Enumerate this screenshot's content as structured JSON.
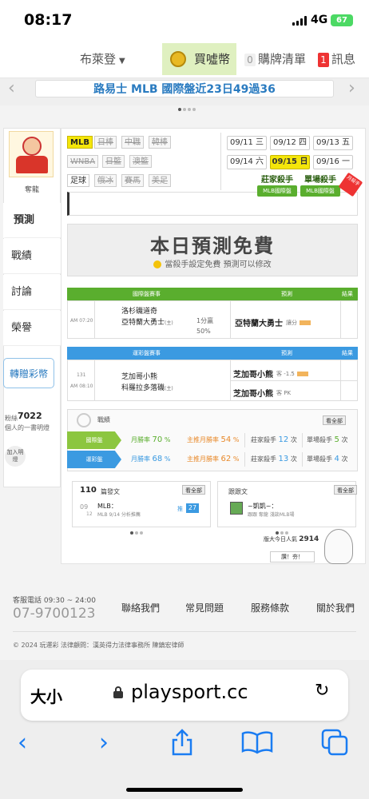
{
  "status_bar": {
    "time": "08:17",
    "network": "4G",
    "battery": "67"
  },
  "top_nav": {
    "region": "布萊登",
    "coin": "買噓幣",
    "cart_count": "0",
    "cart": "購牌清單",
    "msg_count": "1",
    "messages": "訊息"
  },
  "marquee": {
    "text": "路易士 MLB 國際盤近23日49過36"
  },
  "sidebar": {
    "avatar_caption": "奪龍",
    "items": [
      {
        "label": "預測"
      },
      {
        "label": "戰績"
      },
      {
        "label": "討論"
      },
      {
        "label": "榮譽"
      }
    ],
    "transfer_button": "轉贈彩幣",
    "fans_label": "粉絲",
    "fans_count": "7022",
    "fans_sub": "個人的一書明燈",
    "join_button": "加入明燈"
  },
  "leagues": [
    "MLB",
    "日棒",
    "中職",
    "韓棒",
    "WNBA",
    "日籃",
    "澳籃",
    "足球",
    "俄冰",
    "賽馬",
    "美足"
  ],
  "dates": [
    {
      "label": "09/11 三"
    },
    {
      "label": "09/12 四"
    },
    {
      "label": "09/13 五"
    },
    {
      "label": "09/14 六"
    },
    {
      "label": "09/15 日"
    },
    {
      "label": "09/16 一"
    }
  ],
  "badges": {
    "banker_killer": {
      "title": "莊家殺手",
      "sub": "MLB國際盤"
    },
    "single_killer": {
      "title": "單場殺手",
      "sub": "MLB國際盤"
    },
    "king_tag": "月殺手"
  },
  "free_banner": {
    "title": "本日預測免費",
    "subtitle": "當殺手設定免費 預測可以修改"
  },
  "intl_table": {
    "headers": {
      "match": "國際盤賽事",
      "pick": "預測",
      "result": "結果"
    },
    "time": "AM 07:20",
    "team_away": "洛杉磯道奇",
    "team_home": "亞特蘭大勇士",
    "home_tag": "(主)",
    "spread": "1分贏",
    "spread_pct": "50%",
    "pick": "亞特蘭大勇士",
    "pick_type": "讓分"
  },
  "lottery_table": {
    "headers": {
      "match": "運彩盤賽事",
      "pick": "預測",
      "result": "結果"
    },
    "game_no": "131",
    "time": "AM 08:10",
    "team_away": "芝加哥小熊",
    "team_home": "科羅拉多落磯",
    "home_tag": "(主)",
    "pick1": "芝加哥小熊",
    "pick1_type": "客 -1.5",
    "pick2": "芝加哥小熊",
    "pick2_type": "客 PK"
  },
  "record": {
    "title": "戰績",
    "see_all": "看全部",
    "rows": [
      {
        "tag": "國際盤",
        "color": "#8cc63f",
        "month_label": "月勝率",
        "month_val": "70",
        "main_label": "主推月勝率",
        "main_val": "54",
        "banker_label": "莊家殺手",
        "banker_val": "12",
        "single_label": "單場殺手",
        "single_val": "5",
        "unit": "次",
        "pct": "%"
      },
      {
        "tag": "運彩盤",
        "color": "#3b9ae1",
        "month_label": "月勝率",
        "month_val": "68",
        "main_label": "主推月勝率",
        "main_val": "62",
        "banker_label": "莊家殺手",
        "banker_val": "13",
        "single_label": "單場殺手",
        "single_val": "4",
        "unit": "次",
        "pct": "%"
      }
    ]
  },
  "posts_card": {
    "count": "110",
    "title": "篇發文",
    "see_all": "看全部",
    "date_month": "09",
    "date_day": "12",
    "post_title": "MLB：",
    "post_sub": "MLB 9/14 分析推薦",
    "replies_label": "推",
    "replies": "27"
  },
  "replies_card": {
    "title": "跟跟文",
    "see_all": "看全部",
    "user": "~凱凱~：",
    "sub": "跟跟 奪龍 淺談MLB場"
  },
  "popularity": {
    "label": "版大今日人氣",
    "value": "2914"
  },
  "praise_button": "讚！夯！",
  "footer": {
    "service_label": "客服電話 09:30 ~ 24:00",
    "phone": "07-9700123",
    "links": [
      "聯絡我們",
      "常見問題",
      "服務條款",
      "關於我們"
    ],
    "copyright": "© 2024 玩運彩  法律顧問：漢英得力法律事務所 陳鎮宏律師"
  },
  "browser": {
    "text_size": "大小",
    "url": "playsport.cc"
  }
}
